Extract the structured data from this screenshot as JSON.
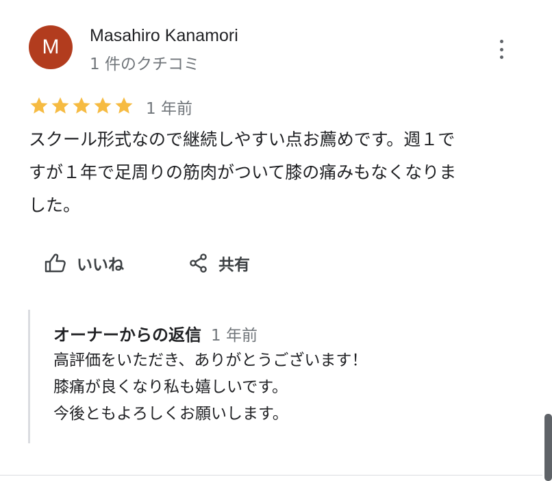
{
  "reviewer": {
    "initial": "M",
    "avatar_color": "#b23c1e",
    "name": "Masahiro Kanamori",
    "reviews_count": "1 件のクチコミ"
  },
  "more_menu_icon": "more-vertical-icon",
  "review": {
    "rating": 5,
    "max_rating": 5,
    "star_color": "#f6bb42",
    "date": "1 年前",
    "text_lines": [
      "スクール形式なので継続しやすい点お薦めです。週１で",
      "すが１年で足周りの筋肉がついて膝の痛みもなくなりま",
      "した。"
    ]
  },
  "actions": {
    "like_label": "いいね",
    "like_icon": "thumb-up-icon",
    "share_label": "共有",
    "share_icon": "share-icon"
  },
  "owner_reply": {
    "title": "オーナーからの返信",
    "date": "1 年前",
    "lines": [
      "高評価をいただき、ありがとうございます！",
      "膝痛が良くなり私も嬉しいです。",
      "今後ともよろしくお願いします。"
    ]
  }
}
